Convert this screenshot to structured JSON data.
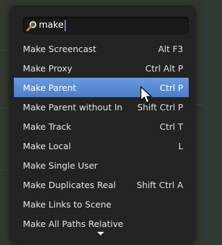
{
  "search": {
    "value": "make",
    "icon": "search-icon"
  },
  "menu": {
    "items": [
      {
        "label": "Make Screencast",
        "shortcut": "Alt F3"
      },
      {
        "label": "Make Proxy",
        "shortcut": "Ctrl Alt P"
      },
      {
        "label": "Make Parent",
        "shortcut": "Ctrl P"
      },
      {
        "label": "Make Parent without In",
        "shortcut": "Shift Ctrl P"
      },
      {
        "label": "Make Track",
        "shortcut": "Ctrl T"
      },
      {
        "label": "Make Local",
        "shortcut": "L"
      },
      {
        "label": "Make Single User",
        "shortcut": ""
      },
      {
        "label": "Make Duplicates Real",
        "shortcut": "Shift Ctrl A"
      },
      {
        "label": "Make Links to Scene",
        "shortcut": ""
      },
      {
        "label": "Make All Paths Relative",
        "shortcut": ""
      }
    ]
  },
  "colors": {
    "highlight": "#5b8bd4",
    "popup_bg": "#232323",
    "text": "#e6e6e6"
  }
}
